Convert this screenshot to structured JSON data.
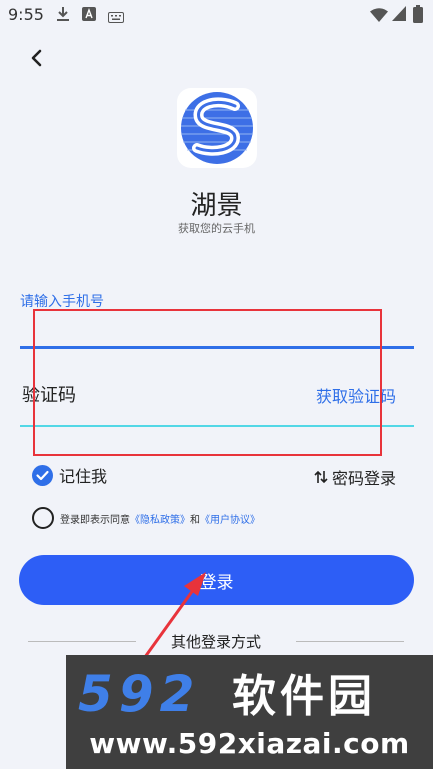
{
  "status_bar": {
    "time": "9:55",
    "left_icons": [
      "download-icon",
      "notification-a-icon",
      "keyboard-icon"
    ],
    "right_icons": [
      "wifi-icon",
      "cellular-icon",
      "battery-icon"
    ]
  },
  "header": {
    "back_icon": "chevron-left-icon"
  },
  "app": {
    "name": "湖景",
    "subtitle": "获取您的云手机"
  },
  "form": {
    "phone_label": "请输入手机号",
    "phone_value": "",
    "code_placeholder": "验证码",
    "get_code_label": "获取验证码",
    "remember_label": "记住我",
    "remember_checked": true,
    "password_login_label": "密码登录",
    "agreement_prefix": "登录即表示同意",
    "privacy_link": "《隐私政策》",
    "agreement_and": "和",
    "user_agreement_link": "《用户协议》",
    "login_button": "登录"
  },
  "other_login": {
    "label": "其他登录方式"
  },
  "colors": {
    "primary": "#2d5ef6",
    "link": "#2f6fe8",
    "accent_line": "#52d7e6",
    "annotation": "#e8333b"
  },
  "watermark": {
    "brand": "592软件园",
    "url": "www.592xiazai.com"
  }
}
